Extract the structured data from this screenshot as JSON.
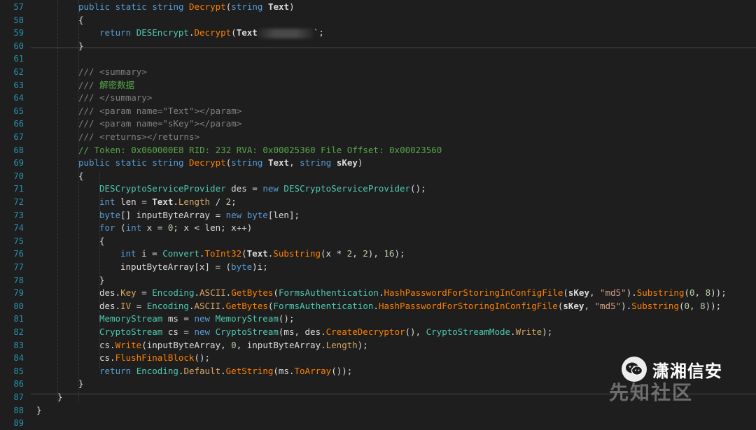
{
  "lines": [
    {
      "n": "57",
      "ind": 2,
      "segs": [
        [
          "kw",
          "public static string "
        ],
        [
          "mt",
          "Decrypt"
        ],
        [
          "",
          "("
        ],
        [
          "kw",
          "string "
        ],
        [
          "pm",
          "Text"
        ],
        [
          "",
          ")"
        ]
      ]
    },
    {
      "n": "58",
      "ind": 2,
      "segs": [
        [
          "",
          "{"
        ]
      ]
    },
    {
      "n": "59",
      "ind": 3,
      "segs": [
        [
          "kw",
          "return "
        ],
        [
          "ty",
          "DESEncrypt"
        ],
        [
          "",
          "."
        ],
        [
          "mt",
          "Decrypt"
        ],
        [
          "",
          "("
        ],
        [
          "pm",
          "Text"
        ],
        [
          "blur",
          ""
        ],
        [
          "",
          "`;"
        ]
      ]
    },
    {
      "n": "60",
      "ind": 2,
      "segs": [
        [
          "",
          "}"
        ]
      ]
    },
    {
      "n": "61",
      "ind": 0,
      "segs": []
    },
    {
      "n": "62",
      "ind": 2,
      "segs": [
        [
          "cmg",
          "/// <summary>"
        ]
      ]
    },
    {
      "n": "63",
      "ind": 2,
      "segs": [
        [
          "cmg",
          "/// "
        ],
        [
          "cm",
          "解密数据"
        ]
      ]
    },
    {
      "n": "64",
      "ind": 2,
      "segs": [
        [
          "cmg",
          "/// </summary>"
        ]
      ]
    },
    {
      "n": "65",
      "ind": 2,
      "segs": [
        [
          "cmg",
          "/// <param name=\"Text\"></param>"
        ]
      ]
    },
    {
      "n": "66",
      "ind": 2,
      "segs": [
        [
          "cmg",
          "/// <param name=\"sKey\"></param>"
        ]
      ]
    },
    {
      "n": "67",
      "ind": 2,
      "segs": [
        [
          "cmg",
          "/// <returns></returns>"
        ]
      ]
    },
    {
      "n": "68",
      "ind": 2,
      "segs": [
        [
          "cm",
          "// Token: 0x060000E8 RID: 232 RVA: 0x00025360 File Offset: 0x00023560"
        ]
      ]
    },
    {
      "n": "69",
      "ind": 2,
      "segs": [
        [
          "kw",
          "public static string "
        ],
        [
          "mt",
          "Decrypt"
        ],
        [
          "",
          "("
        ],
        [
          "kw",
          "string "
        ],
        [
          "pm",
          "Text"
        ],
        [
          "",
          ", "
        ],
        [
          "kw",
          "string "
        ],
        [
          "pm",
          "sKey"
        ],
        [
          "",
          ")"
        ]
      ]
    },
    {
      "n": "70",
      "ind": 2,
      "segs": [
        [
          "",
          "{"
        ]
      ]
    },
    {
      "n": "71",
      "ind": 3,
      "segs": [
        [
          "ty",
          "DESCryptoServiceProvider"
        ],
        [
          "",
          " des = "
        ],
        [
          "kw",
          "new "
        ],
        [
          "ty",
          "DESCryptoServiceProvider"
        ],
        [
          "",
          "();"
        ]
      ]
    },
    {
      "n": "72",
      "ind": 3,
      "segs": [
        [
          "kw",
          "int"
        ],
        [
          "",
          " len = "
        ],
        [
          "pm",
          "Text"
        ],
        [
          "",
          "."
        ],
        [
          "pr",
          "Length"
        ],
        [
          "",
          " / "
        ],
        [
          "nm",
          "2"
        ],
        [
          "",
          ";"
        ]
      ]
    },
    {
      "n": "73",
      "ind": 3,
      "segs": [
        [
          "kw",
          "byte"
        ],
        [
          "",
          "[] inputByteArray = "
        ],
        [
          "kw",
          "new byte"
        ],
        [
          "",
          "[len];"
        ]
      ]
    },
    {
      "n": "74",
      "ind": 3,
      "segs": [
        [
          "kw",
          "for "
        ],
        [
          "",
          "("
        ],
        [
          "kw",
          "int"
        ],
        [
          "",
          " x = "
        ],
        [
          "nm",
          "0"
        ],
        [
          "",
          "; x < len; x++)"
        ]
      ]
    },
    {
      "n": "75",
      "ind": 3,
      "segs": [
        [
          "",
          "{"
        ]
      ]
    },
    {
      "n": "76",
      "ind": 4,
      "segs": [
        [
          "kw",
          "int"
        ],
        [
          "",
          " i = "
        ],
        [
          "ty",
          "Convert"
        ],
        [
          "",
          "."
        ],
        [
          "mt",
          "ToInt32"
        ],
        [
          "",
          "("
        ],
        [
          "pm",
          "Text"
        ],
        [
          "",
          "."
        ],
        [
          "mt",
          "Substring"
        ],
        [
          "",
          "(x * "
        ],
        [
          "nm",
          "2"
        ],
        [
          "",
          ", "
        ],
        [
          "nm",
          "2"
        ],
        [
          "",
          "), "
        ],
        [
          "nm",
          "16"
        ],
        [
          "",
          ");"
        ]
      ]
    },
    {
      "n": "77",
      "ind": 4,
      "segs": [
        [
          "",
          "inputByteArray[x] = ("
        ],
        [
          "kw",
          "byte"
        ],
        [
          "",
          ")i;"
        ]
      ]
    },
    {
      "n": "78",
      "ind": 3,
      "segs": [
        [
          "",
          "}"
        ]
      ]
    },
    {
      "n": "79",
      "ind": 3,
      "segs": [
        [
          "",
          "des."
        ],
        [
          "pr",
          "Key"
        ],
        [
          "",
          " = "
        ],
        [
          "ty",
          "Encoding"
        ],
        [
          "",
          "."
        ],
        [
          "pr",
          "ASCII"
        ],
        [
          "",
          "."
        ],
        [
          "mt",
          "GetBytes"
        ],
        [
          "",
          "("
        ],
        [
          "ty",
          "FormsAuthentication"
        ],
        [
          "",
          "."
        ],
        [
          "mt",
          "HashPasswordForStoringInConfigFile"
        ],
        [
          "",
          "("
        ],
        [
          "pm",
          "sKey"
        ],
        [
          "",
          ", "
        ],
        [
          "st",
          "\"md5\""
        ],
        [
          "",
          ")."
        ],
        [
          "mt",
          "Substring"
        ],
        [
          "",
          "("
        ],
        [
          "nm",
          "0"
        ],
        [
          "",
          ", "
        ],
        [
          "nm",
          "8"
        ],
        [
          "",
          "));"
        ]
      ]
    },
    {
      "n": "80",
      "ind": 3,
      "segs": [
        [
          "",
          "des."
        ],
        [
          "pr",
          "IV"
        ],
        [
          "",
          " = "
        ],
        [
          "ty",
          "Encoding"
        ],
        [
          "",
          "."
        ],
        [
          "pr",
          "ASCII"
        ],
        [
          "",
          "."
        ],
        [
          "mt",
          "GetBytes"
        ],
        [
          "",
          "("
        ],
        [
          "ty",
          "FormsAuthentication"
        ],
        [
          "",
          "."
        ],
        [
          "mt",
          "HashPasswordForStoringInConfigFile"
        ],
        [
          "",
          "("
        ],
        [
          "pm",
          "sKey"
        ],
        [
          "",
          ", "
        ],
        [
          "st",
          "\"md5\""
        ],
        [
          "",
          ")."
        ],
        [
          "mt",
          "Substring"
        ],
        [
          "",
          "("
        ],
        [
          "nm",
          "0"
        ],
        [
          "",
          ", "
        ],
        [
          "nm",
          "8"
        ],
        [
          "",
          "));"
        ]
      ]
    },
    {
      "n": "81",
      "ind": 3,
      "segs": [
        [
          "ty",
          "MemoryStream"
        ],
        [
          "",
          " ms = "
        ],
        [
          "kw",
          "new "
        ],
        [
          "ty",
          "MemoryStream"
        ],
        [
          "",
          "();"
        ]
      ]
    },
    {
      "n": "82",
      "ind": 3,
      "segs": [
        [
          "ty",
          "CryptoStream"
        ],
        [
          "",
          " cs = "
        ],
        [
          "kw",
          "new "
        ],
        [
          "ty",
          "CryptoStream"
        ],
        [
          "",
          "(ms, des."
        ],
        [
          "mt",
          "CreateDecryptor"
        ],
        [
          "",
          "(), "
        ],
        [
          "ty",
          "CryptoStreamMode"
        ],
        [
          "",
          "."
        ],
        [
          "pr",
          "Write"
        ],
        [
          "",
          ");"
        ]
      ]
    },
    {
      "n": "83",
      "ind": 3,
      "segs": [
        [
          "",
          "cs."
        ],
        [
          "mt",
          "Write"
        ],
        [
          "",
          "(inputByteArray, "
        ],
        [
          "nm",
          "0"
        ],
        [
          "",
          ", inputByteArray."
        ],
        [
          "pr",
          "Length"
        ],
        [
          "",
          ");"
        ]
      ]
    },
    {
      "n": "84",
      "ind": 3,
      "segs": [
        [
          "",
          "cs."
        ],
        [
          "mt",
          "FlushFinalBlock"
        ],
        [
          "",
          "();"
        ]
      ]
    },
    {
      "n": "85",
      "ind": 3,
      "segs": [
        [
          "kw",
          "return "
        ],
        [
          "ty",
          "Encoding"
        ],
        [
          "",
          "."
        ],
        [
          "pr",
          "Default"
        ],
        [
          "",
          "."
        ],
        [
          "mt",
          "GetString"
        ],
        [
          "",
          "(ms."
        ],
        [
          "mt",
          "ToArray"
        ],
        [
          "",
          "());"
        ]
      ]
    },
    {
      "n": "86",
      "ind": 2,
      "segs": [
        [
          "",
          "}"
        ]
      ]
    },
    {
      "n": "87",
      "ind": 1,
      "segs": [
        [
          "",
          "}"
        ]
      ]
    },
    {
      "n": "88",
      "ind": 0,
      "segs": [
        [
          "",
          "}"
        ]
      ]
    },
    {
      "n": "89",
      "ind": 0,
      "segs": []
    }
  ],
  "watermark": {
    "brand": "潇湘信安",
    "overlay": "先知社区"
  },
  "colors": {
    "background": "#1e1e1e",
    "line_number": "#2b91af",
    "keyword": "#569cd6",
    "type": "#4ec9b0",
    "method": "#ff8000",
    "comment": "#57a64a",
    "doc_comment": "#808080",
    "string": "#d69d85",
    "number": "#b5cea8"
  }
}
